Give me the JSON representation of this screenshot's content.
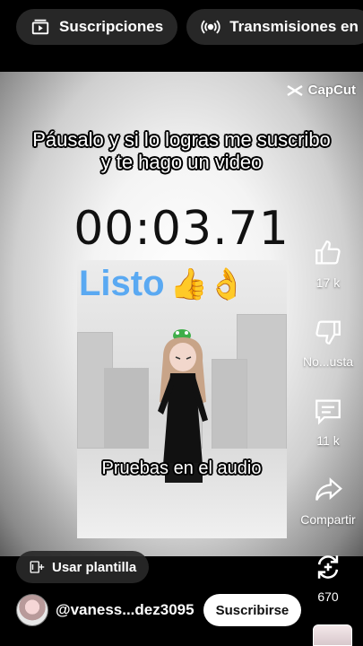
{
  "top_tabs": [
    {
      "label": "Suscripciones",
      "icon": "subscriptions-icon"
    },
    {
      "label": "Transmisiones en",
      "icon": "live-icon"
    }
  ],
  "video": {
    "watermark": "CapCut",
    "caption_top_line1": "Páusalo y si lo logras me suscribo",
    "caption_top_line2": "y te hago un video",
    "timer": "00:03.71",
    "scene_heading": "Listo",
    "scene_emoji": "👍👌",
    "caption_bottom": "Pruebas en el audio"
  },
  "actions": {
    "like_count": "17 k",
    "dislike_label": "No...usta",
    "comments_count": "11 k",
    "share_label": "Compartir",
    "remix_count": "670"
  },
  "template_chip": {
    "label": "Usar plantilla"
  },
  "channel": {
    "handle": "@vaness...dez3095",
    "subscribe_label": "Suscribirse"
  },
  "colors": {
    "accent_blue": "#5aa9f2",
    "chip_bg": "#272727"
  }
}
